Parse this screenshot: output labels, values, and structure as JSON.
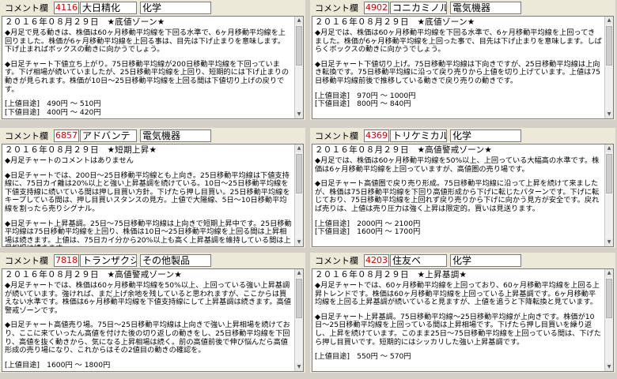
{
  "panels": [
    {
      "label": "コメント欄",
      "code": "4116",
      "name": "大日精化",
      "sector": "化学",
      "date_line": "２０１６年０８月２９日　★底値ゾーン★",
      "monthly": "◆月足で見る動きは、株価は60ヶ月移動平均線を下回る水準で、6ヶ月移動平均線を上回りました。株価が6ヶ月移動平均線を上回る事は、目先は下げ止まりを意味します。下げ止まればボックスの動きに向かうでしょう。",
      "daily": "◆日足チャート下値立ち上がり。75日移動平均線が200日移動平均線を下回っています。下げ相場が続いていましたが、25日移動平均線を上回り、短期的には下げ止まりの動きが見られます。株価が10日〜25日移動平均線を上回る間は下値切り上げの戻りです。",
      "target_up": "[上値目途]　490円 〜 510円",
      "target_down": "[下値目途]　400円 〜 420円"
    },
    {
      "label": "コメント欄",
      "code": "4902",
      "name": "コニカミノルタ",
      "sector": "電気機器",
      "date_line": "２０１６年０８月２９日　★底値ゾーン★",
      "monthly": "◆月足では、株価は60ヶ月移動平均線を下回る水準で、6ヶ月移動平均線を上回ってきました。株価が6ヶ月移動平均線を上回った事で、目先は下げ止まりを意味します。しばらくボックスの動きに向かうでしょう。",
      "daily": "◆日足チャート下値切り上げ。75日移動平均線は下向きですが、25日移動平均線は上向き転換です。75日移動平均線に沿って戻り売りから上値を切り上げています。上値は75日移動平均線前後で推移している動きで戻り売りの動きです。",
      "target_up": "[上値目途]　970円 〜 1000円",
      "target_down": "[下値目途]　800円 〜 840円"
    },
    {
      "label": "コメント欄",
      "code": "6857",
      "name": "アドバンテ",
      "sector": "電気機器",
      "date_line": "２０１６年０８月２９日　★短期上昇★",
      "monthly": "◆月足チャートのコメントはありません",
      "daily": "◆日足チャートでは、200日〜25日移動平均線とも上向き。25日移動平均線は下値支持線に、75日カイ離は20%以上と強い上昇基調を続けている。10日〜25日移動平均線を下値支持線に続いている間は押し目買い方針。下げたら押し目買い。25日移動平均線をキープしている間は、押し目買いスタンスの見方。上値で大陽線、5日〜10日移動平均線を割ったら売りシグナル。",
      "daily2": "◆日足チャート上昇基調。25日〜75日移動平均線は上向きで短期上昇中です。25日移動平均線は75日移動平均線を上回り、株価は10日〜25日移動平均線を上回る間は上昇相場は続きます。上値は、75日カイ分から20%以上も高く上昇基調を維持している間は上昇相場は続きます。",
      "target_up": "",
      "target_down": ""
    },
    {
      "label": "コメント欄",
      "code": "4369",
      "name": "トリケミカル",
      "sector": "化学",
      "date_line": "２０１６年０８月２９日　★高値警戒ゾーン★",
      "monthly": "◆月足では、株価は60ヶ月移動平均線を50%以上、上回っている大幅高の水準です。株価は6ヶ月移動平均線を上回っていますが、高値圏の売り場です。",
      "daily": "◆日足チャート高値圏で戻り売り形成。75日移動平均線に沿って上昇を続けて来ましたが、株価は75日移動平均線を下回り高値形成から下げに転じたパターンです。下げに転じており、75日移動平均線を上回れず戻り売りから下げに向かう見方が安全です。戻れば売りは、上値は売り圧力は強く上昇は限定的。買いは見送ります。",
      "target_up": "[上値目途]　2000円 〜 2100円",
      "target_down": "[下値目途]　1600円 〜 1700円"
    },
    {
      "label": "コメント欄",
      "code": "7818",
      "name": "トランザクシ",
      "sector": "その他製品",
      "date_line": "２０１６年０８月２９日　★高値警戒ゾーン★",
      "monthly": "◆月足チャートでは、株価は60ヶ月移動平均線を50%以上、上回っている強い上昇基調が続いています。強ければ、まだ上げ余地を残していると思われますが、ここからは買えない水準です。株価は6ヶ月移動平均線を下値支持線にして上昇基調は続きます。高値警戒ゾーンです。",
      "daily": "◆日足チャート高値売り場。75日〜25日移動平均線は上向きで強い上昇相場を続けており、ここに来ていったん高値を付けた後の切り返しの動きをし、25日移動平均線を下回り、高値を抜く動きから、気になる上昇相場は続く。前の高値前後で伸び悩んだら高値形成の売り場になり、これからはその2値目の動きの確認を。",
      "target_up": "[上値目途]　1600円 〜 1800円",
      "target_down": ""
    },
    {
      "label": "コメント欄",
      "code": "4203",
      "name": "住友ベ",
      "sector": "化学",
      "date_line": "２０１６年０８月２９日　★上昇基調★",
      "monthly": "◆月足チャートでは、60ヶ月移動平均線を上回っており、60ヶ月移動平均線を上回る上昇トレンドです。株価は60ヶ月移動平均線を上回っている上昇基調です。6ヶ月移動平均線を上回る上昇基調が続いていると見ますが、上値を追うと下降転換と見ています。",
      "daily": "◆日足チャート上昇基調。75日移動平均線〜25日移動平均線が上向きです。株価が10日〜25日移動平均線を上回っている間は上昇相場です。下げたら押し目買いを繰り返し、上昇を続けています。このまま25日〜75日移動平均線を上回っている間は、下げたら押し目買いです。短期的にはシッカリした強い上昇基調です。",
      "target_up": "[上値目途]　550円 〜 570円",
      "target_down": ""
    }
  ]
}
